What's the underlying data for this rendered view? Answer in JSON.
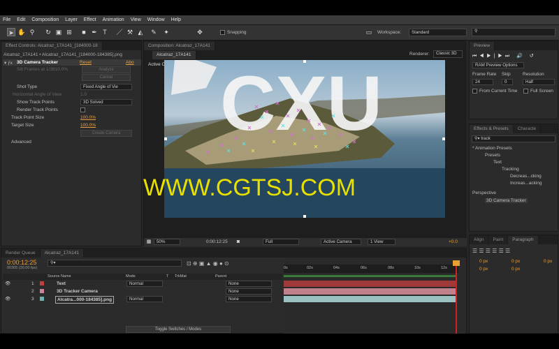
{
  "menu": [
    "File",
    "Edit",
    "Composition",
    "Layer",
    "Effect",
    "Animation",
    "View",
    "Window",
    "Help"
  ],
  "toolbar": {
    "snapping": "Snapping",
    "workspace_label": "Workspace:",
    "workspace_value": "Standard"
  },
  "effect_controls": {
    "tab": "Effect Controls: Alcatraz_17A141_[184000-18",
    "breadcrumb": "Alcatraz_17A141 • Alcatraz_17A141_[184000-184385].png",
    "effect_name": "3D Camera Tracker",
    "reset": "Reset",
    "about": "Abo",
    "analyze": "Analyze",
    "cancel": "Cancel",
    "status": "Silt Frames at 1/3810.0%",
    "shot_type_label": "Shot Type",
    "shot_type_value": "Fixed Angle of Vie",
    "fov_label": "Horizontal Angle of View",
    "fov_value": "1.0",
    "show_track_label": "Show Track Points",
    "show_track_value": "3D Solved",
    "render_track_label": "Render Track Points",
    "track_size_label": "Track Point Size",
    "track_size_value": "100.0%",
    "target_size_label": "Target Size",
    "target_size_value": "100.0%",
    "create_camera": "Create Camera",
    "advanced": "Advanced"
  },
  "composition": {
    "tab": "Composition: Alcatraz_17A141",
    "subtab": "Alcatraz_17A141",
    "renderer_label": "Renderer:",
    "renderer_value": "Classic 3D",
    "view_label": "Active Camera",
    "zoom": "50%",
    "timecode": "0:00:12:25",
    "resolution": "Full",
    "camera": "Active Camera",
    "views": "1 View",
    "offset": "+0.0",
    "overlay_text": "CXU"
  },
  "watermark": "WWW.CGTSJ.COM",
  "preview": {
    "tab": "Preview",
    "options": "RAM Preview Options",
    "frame_rate_label": "Frame Rate",
    "skip_label": "Skip",
    "resolution_label": "Resolution",
    "frame_rate_value": "24",
    "skip_value": "0",
    "resolution_value": "Half",
    "from_current": "From Current Time",
    "full_screen": "Full Screen"
  },
  "effects": {
    "tab": "Effects & Presets",
    "tab2": "Characte",
    "search": "track",
    "tree": [
      "* Animation Presets",
      "Presets",
      "Text",
      "Tracking",
      "Decreas...cking",
      "Increas...acking",
      "Perspective",
      "3D Camera Tracker"
    ]
  },
  "paragraph": {
    "tabs": [
      "Align",
      "Paint",
      "Paragraph"
    ],
    "px": [
      "0 px",
      "0 px",
      "0 px",
      "0 px",
      "0 px"
    ]
  },
  "timeline": {
    "tabs": [
      "Render Queue",
      "Alcatraz_17A141"
    ],
    "timecode": "0:00:12:25",
    "frame_info": "00305 (30.00 fps)",
    "headers": {
      "source": "Source Name",
      "mode": "Mode",
      "t": "T",
      "trkmat": "TrkMat",
      "parent": "Parent"
    },
    "layers": [
      {
        "num": "1",
        "name": "Text",
        "mode": "Normal",
        "parent": "None",
        "color": "#c04040"
      },
      {
        "num": "2",
        "name": "3D Tracker Camera",
        "mode": "",
        "parent": "None",
        "color": "#d080a0"
      },
      {
        "num": "3",
        "name": "Alcatra...000-184385].png",
        "mode": "Normal",
        "parent": "None",
        "color": "#70b0b0"
      }
    ],
    "ruler": [
      "0s",
      "02s",
      "04s",
      "06s",
      "08s",
      "10s",
      "12s"
    ],
    "toggle": "Toggle Switches / Modes"
  }
}
